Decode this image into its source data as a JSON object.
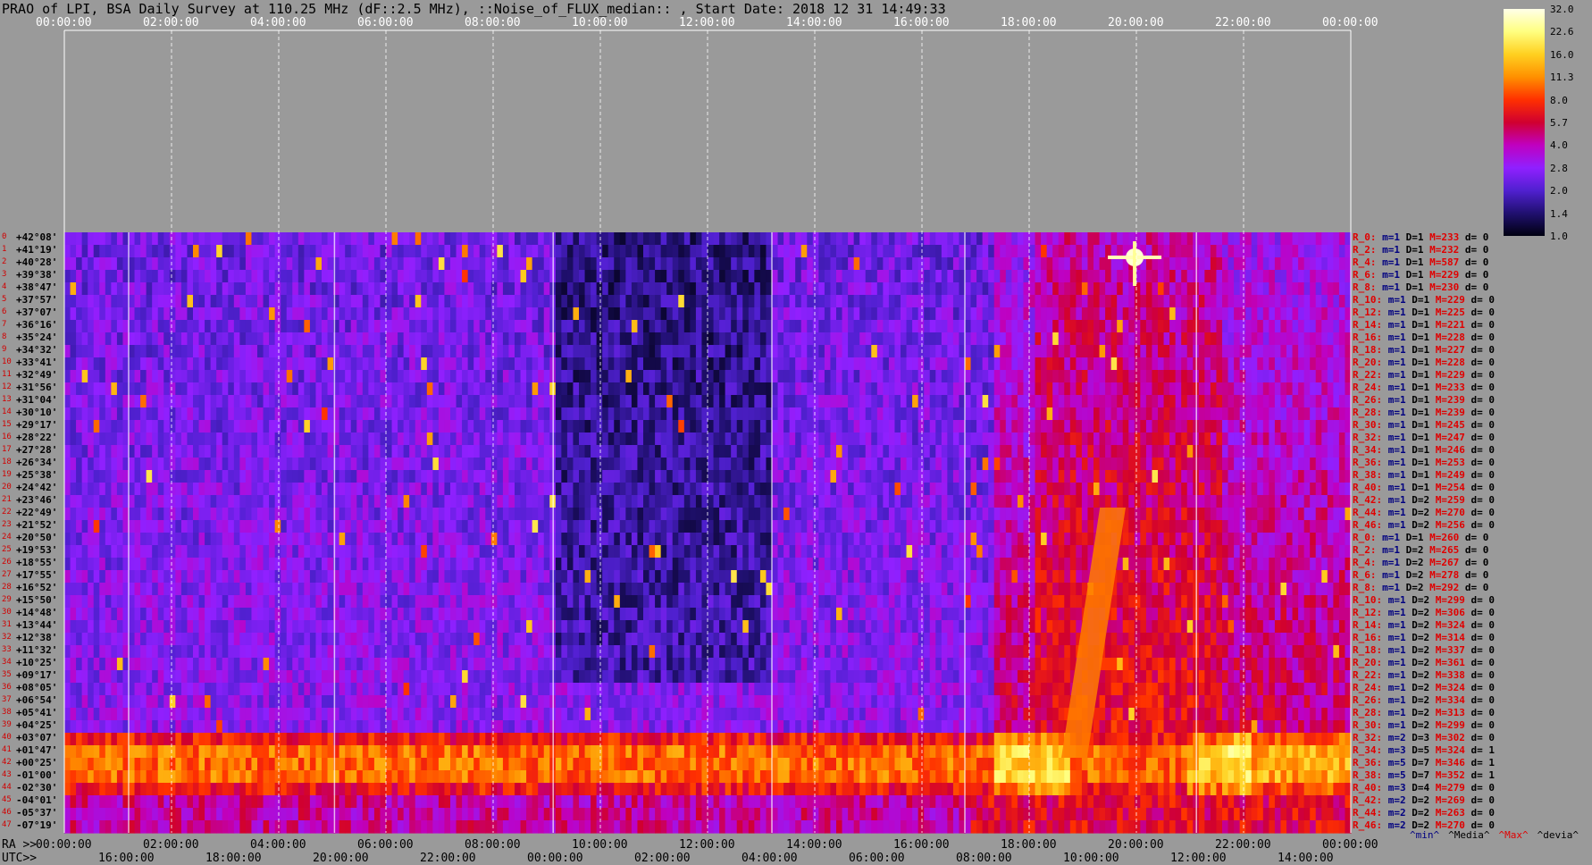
{
  "title": "PRAO of LPI, BSA Daily Survey at 110.25 MHz (dF::2.5 MHz), ::Noise_of_FLUX_median:: , Start Date: 2018 12 31 14:49:33",
  "chart_data": {
    "type": "heatmap",
    "title": "PRAO of LPI, BSA Daily Survey at 110.25 MHz (dF::2.5 MHz), ::Noise_of_FLUX_median:: , Start Date: 2018 12 31 14:49:33",
    "top_time_ticks": [
      "00:00:00",
      "02:00:00",
      "04:00:00",
      "06:00:00",
      "08:00:00",
      "10:00:00",
      "12:00:00",
      "14:00:00",
      "16:00:00",
      "18:00:00",
      "20:00:00",
      "22:00:00",
      "00:00:00"
    ],
    "ra_label": "RA >>",
    "ra_ticks": [
      "00:00:00",
      "02:00:00",
      "04:00:00",
      "06:00:00",
      "08:00:00",
      "10:00:00",
      "12:00:00",
      "14:00:00",
      "16:00:00",
      "18:00:00",
      "20:00:00",
      "22:00:00",
      "00:00:00"
    ],
    "utc_label": "UTC>>",
    "utc_ticks": [
      "16:00:00",
      "18:00:00",
      "20:00:00",
      "22:00:00",
      "00:00:00",
      "02:00:00",
      "04:00:00",
      "06:00:00",
      "08:00:00",
      "10:00:00",
      "12:00:00",
      "14:00:00"
    ],
    "declinations": [
      "+42°08'",
      "+41°19'",
      "+40°28'",
      "+39°38'",
      "+38°47'",
      "+37°57'",
      "+37°07'",
      "+36°16'",
      "+35°24'",
      "+34°32'",
      "+33°41'",
      "+32°49'",
      "+31°56'",
      "+31°04'",
      "+30°10'",
      "+29°17'",
      "+28°22'",
      "+27°28'",
      "+26°34'",
      "+25°38'",
      "+24°42'",
      "+23°46'",
      "+22°49'",
      "+21°52'",
      "+20°50'",
      "+19°53'",
      "+18°55'",
      "+17°55'",
      "+16°52'",
      "+15°50'",
      "+14°48'",
      "+13°44'",
      "+12°38'",
      "+11°32'",
      "+10°25'",
      "+09°17'",
      "+08°05'",
      "+06°54'",
      "+05°41'",
      "+04°25'",
      "+03°07'",
      "+01°47'",
      "+00°25'",
      "-01°00'",
      "-02°30'",
      "-04°01'",
      "-05°37'",
      "-07°19'"
    ],
    "row_stats": [
      {
        "r": "R_0:",
        "m": "m=1",
        "D": "D=1",
        "M": "M=233",
        "d": "d= 0"
      },
      {
        "r": "R_2:",
        "m": "m=1",
        "D": "D=1",
        "M": "M=232",
        "d": "d= 0"
      },
      {
        "r": "R_4:",
        "m": "m=1",
        "D": "D=1",
        "M": "M=587",
        "d": "d= 0"
      },
      {
        "r": "R_6:",
        "m": "m=1",
        "D": "D=1",
        "M": "M=229",
        "d": "d= 0"
      },
      {
        "r": "R_8:",
        "m": "m=1",
        "D": "D=1",
        "M": "M=230",
        "d": "d= 0"
      },
      {
        "r": "R_10:",
        "m": "m=1",
        "D": "D=1",
        "M": "M=229",
        "d": "d= 0"
      },
      {
        "r": "R_12:",
        "m": "m=1",
        "D": "D=1",
        "M": "M=225",
        "d": "d= 0"
      },
      {
        "r": "R_14:",
        "m": "m=1",
        "D": "D=1",
        "M": "M=221",
        "d": "d= 0"
      },
      {
        "r": "R_16:",
        "m": "m=1",
        "D": "D=1",
        "M": "M=228",
        "d": "d= 0"
      },
      {
        "r": "R_18:",
        "m": "m=1",
        "D": "D=1",
        "M": "M=227",
        "d": "d= 0"
      },
      {
        "r": "R_20:",
        "m": "m=1",
        "D": "D=1",
        "M": "M=228",
        "d": "d= 0"
      },
      {
        "r": "R_22:",
        "m": "m=1",
        "D": "D=1",
        "M": "M=229",
        "d": "d= 0"
      },
      {
        "r": "R_24:",
        "m": "m=1",
        "D": "D=1",
        "M": "M=233",
        "d": "d= 0"
      },
      {
        "r": "R_26:",
        "m": "m=1",
        "D": "D=1",
        "M": "M=239",
        "d": "d= 0"
      },
      {
        "r": "R_28:",
        "m": "m=1",
        "D": "D=1",
        "M": "M=239",
        "d": "d= 0"
      },
      {
        "r": "R_30:",
        "m": "m=1",
        "D": "D=1",
        "M": "M=245",
        "d": "d= 0"
      },
      {
        "r": "R_32:",
        "m": "m=1",
        "D": "D=1",
        "M": "M=247",
        "d": "d= 0"
      },
      {
        "r": "R_34:",
        "m": "m=1",
        "D": "D=1",
        "M": "M=246",
        "d": "d= 0"
      },
      {
        "r": "R_36:",
        "m": "m=1",
        "D": "D=1",
        "M": "M=253",
        "d": "d= 0"
      },
      {
        "r": "R_38:",
        "m": "m=1",
        "D": "D=1",
        "M": "M=249",
        "d": "d= 0"
      },
      {
        "r": "R_40:",
        "m": "m=1",
        "D": "D=1",
        "M": "M=254",
        "d": "d= 0"
      },
      {
        "r": "R_42:",
        "m": "m=1",
        "D": "D=2",
        "M": "M=259",
        "d": "d= 0"
      },
      {
        "r": "R_44:",
        "m": "m=1",
        "D": "D=2",
        "M": "M=270",
        "d": "d= 0"
      },
      {
        "r": "R_46:",
        "m": "m=1",
        "D": "D=2",
        "M": "M=256",
        "d": "d= 0"
      },
      {
        "r": "R_0:",
        "m": "m=1",
        "D": "D=1",
        "M": "M=260",
        "d": "d= 0"
      },
      {
        "r": "R_2:",
        "m": "m=1",
        "D": "D=2",
        "M": "M=265",
        "d": "d= 0"
      },
      {
        "r": "R_4:",
        "m": "m=1",
        "D": "D=2",
        "M": "M=267",
        "d": "d= 0"
      },
      {
        "r": "R_6:",
        "m": "m=1",
        "D": "D=2",
        "M": "M=278",
        "d": "d= 0"
      },
      {
        "r": "R_8:",
        "m": "m=1",
        "D": "D=2",
        "M": "M=292",
        "d": "d= 0"
      },
      {
        "r": "R_10:",
        "m": "m=1",
        "D": "D=2",
        "M": "M=299",
        "d": "d= 0"
      },
      {
        "r": "R_12:",
        "m": "m=1",
        "D": "D=2",
        "M": "M=306",
        "d": "d= 0"
      },
      {
        "r": "R_14:",
        "m": "m=1",
        "D": "D=2",
        "M": "M=324",
        "d": "d= 0"
      },
      {
        "r": "R_16:",
        "m": "m=1",
        "D": "D=2",
        "M": "M=314",
        "d": "d= 0"
      },
      {
        "r": "R_18:",
        "m": "m=1",
        "D": "D=2",
        "M": "M=337",
        "d": "d= 0"
      },
      {
        "r": "R_20:",
        "m": "m=1",
        "D": "D=2",
        "M": "M=361",
        "d": "d= 0"
      },
      {
        "r": "R_22:",
        "m": "m=1",
        "D": "D=2",
        "M": "M=338",
        "d": "d= 0"
      },
      {
        "r": "R_24:",
        "m": "m=1",
        "D": "D=2",
        "M": "M=324",
        "d": "d= 0"
      },
      {
        "r": "R_26:",
        "m": "m=1",
        "D": "D=2",
        "M": "M=334",
        "d": "d= 0"
      },
      {
        "r": "R_28:",
        "m": "m=1",
        "D": "D=2",
        "M": "M=313",
        "d": "d= 0"
      },
      {
        "r": "R_30:",
        "m": "m=1",
        "D": "D=2",
        "M": "M=299",
        "d": "d= 0"
      },
      {
        "r": "R_32:",
        "m": "m=2",
        "D": "D=3",
        "M": "M=302",
        "d": "d= 0"
      },
      {
        "r": "R_34:",
        "m": "m=3",
        "D": "D=5",
        "M": "M=324",
        "d": "d= 1"
      },
      {
        "r": "R_36:",
        "m": "m=5",
        "D": "D=7",
        "M": "M=346",
        "d": "d= 1"
      },
      {
        "r": "R_38:",
        "m": "m=5",
        "D": "D=7",
        "M": "M=352",
        "d": "d= 1"
      },
      {
        "r": "R_40:",
        "m": "m=3",
        "D": "D=4",
        "M": "M=279",
        "d": "d= 0"
      },
      {
        "r": "R_42:",
        "m": "m=2",
        "D": "D=2",
        "M": "M=269",
        "d": "d= 0"
      },
      {
        "r": "R_44:",
        "m": "m=2",
        "D": "D=2",
        "M": "M=263",
        "d": "d= 0"
      },
      {
        "r": "R_46:",
        "m": "m=2",
        "D": "D=2",
        "M": "M=270",
        "d": "d= 0"
      }
    ],
    "colorbar": {
      "ticks": [
        "32.0",
        "22.6",
        "16.0",
        "11.3",
        "8.0",
        "5.7",
        "4.0",
        "2.8",
        "2.0",
        "1.4",
        "1.0"
      ],
      "stops": [
        "#ffffe8",
        "#ffff80",
        "#ffd020",
        "#ff9000",
        "#ff3000",
        "#d00030",
        "#c000c0",
        "#9020ff",
        "#5020d0",
        "#201070",
        "#000010"
      ]
    },
    "bottom_legend": [
      "^min^",
      "^Media^",
      "^Max^",
      "^devia^"
    ],
    "legend_colors": [
      "#000080",
      "#000000",
      "#e00000",
      "#000000"
    ],
    "features": [
      {
        "type": "band",
        "dec_from": "+03°07'",
        "dec_to": "-02°30'",
        "level": "high"
      },
      {
        "type": "source",
        "ra": "20:00:00",
        "dec": "+40°28'",
        "level": "max"
      },
      {
        "type": "drift",
        "ra_from": "20:00:00",
        "ra_to": "19:00:00",
        "dec_from": "+22°49'",
        "dec_to": "+01°47'"
      }
    ]
  }
}
